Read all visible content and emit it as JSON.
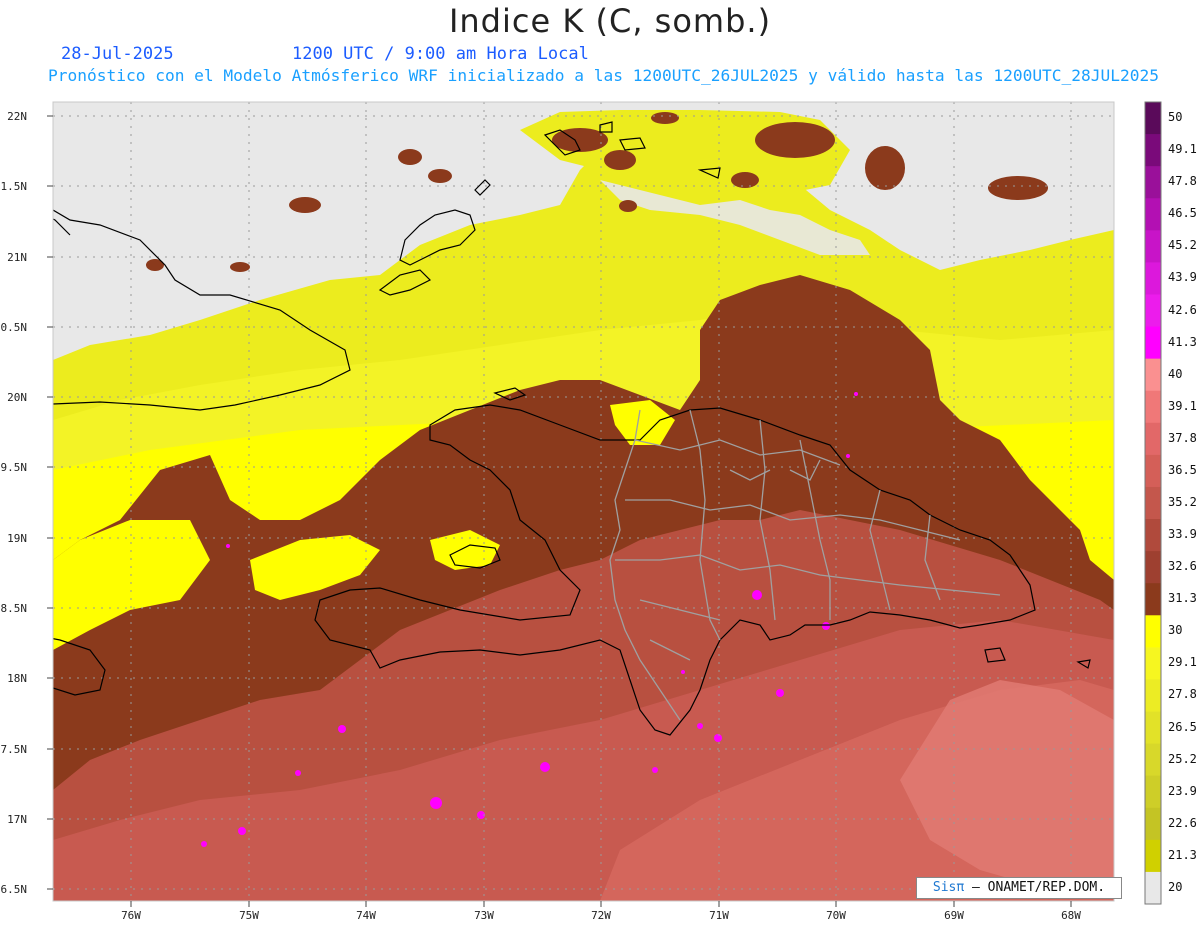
{
  "header": {
    "title": "Indice K (C, somb.)",
    "date": "28-Jul-2025",
    "time": "1200 UTC / 9:00 am Hora Local",
    "description": "Pronóstico con el Modelo Atmósferico WRF inicializado a las 1200UTC_26JUL2025 y válido hasta las  1200UTC_28JUL2025"
  },
  "map": {
    "lat_labels": [
      "22N",
      "21.5N",
      "21N",
      "20.5N",
      "20N",
      "19.5N",
      "19N",
      "18.5N",
      "18N",
      "17.5N",
      "17N",
      "16.5N"
    ],
    "lon_labels": [
      "76W",
      "75W",
      "74W",
      "73W",
      "72W",
      "71W",
      "70W",
      "69W",
      "68W"
    ],
    "extent": {
      "lon": [
        -76.65,
        -67.6
      ],
      "lat": [
        16.45,
        22.1
      ]
    },
    "colors": {
      "no_data": "#e8e8e8",
      "low": "#f0f030",
      "warm": "#8b3a1c",
      "hot": "#c85a50",
      "very_hot": "#e07070",
      "extreme": "#ff00ff",
      "border": "#000000",
      "provinces": "#a0a0a0"
    }
  },
  "colorbar": {
    "labels": [
      "50",
      "49.1",
      "47.8",
      "46.5",
      "45.2",
      "43.9",
      "42.6",
      "41.3",
      "40",
      "39.1",
      "37.8",
      "36.5",
      "35.2",
      "33.9",
      "32.6",
      "31.3",
      "30",
      "29.1",
      "27.8",
      "26.5",
      "25.2",
      "23.9",
      "22.6",
      "21.3",
      "20"
    ],
    "colors": [
      "#5a0a5a",
      "#7a0a7a",
      "#9a109a",
      "#b310b3",
      "#c814c8",
      "#dc18dc",
      "#ec1cec",
      "#ff00ff",
      "#fa9090",
      "#f07878",
      "#e26868",
      "#d45f58",
      "#c4574c",
      "#b04a3c",
      "#9e4030",
      "#8b3a1c",
      "#ffff00",
      "#f6f620",
      "#ecec24",
      "#e2e228",
      "#d8d82a",
      "#cece28",
      "#c4c424",
      "#d0d000",
      "#e8e8e8"
    ]
  },
  "credit": {
    "logo": "Sisπ",
    "text": "– ONAMET/REP.DOM."
  }
}
